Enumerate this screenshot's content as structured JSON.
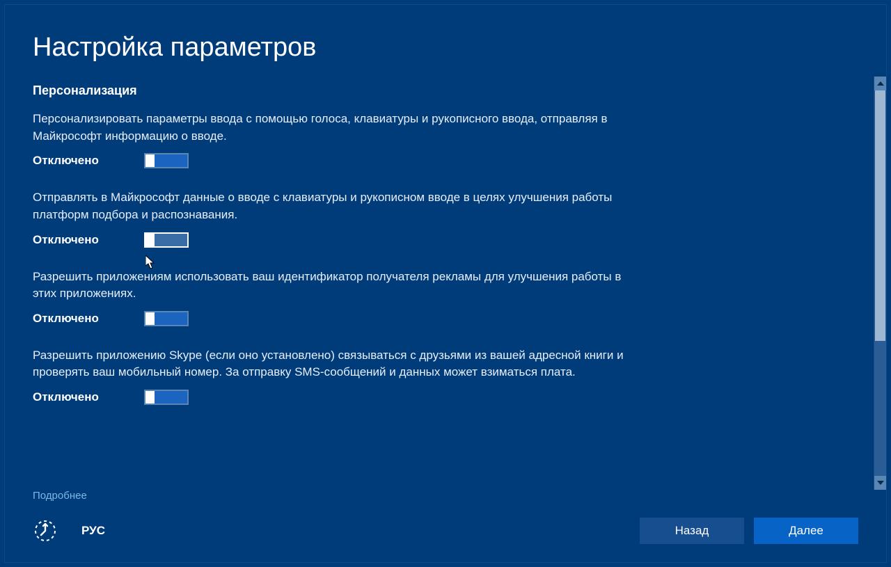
{
  "title": "Настройка параметров",
  "section_heading": "Персонализация",
  "state_off": "Отключено",
  "settings": [
    {
      "desc": "Персонализировать параметры ввода с помощью голоса, клавиатуры и рукописного ввода, отправляя в Майкрософт информацию о вводе.",
      "state": "Отключено",
      "hover": false
    },
    {
      "desc": "Отправлять в Майкрософт данные о вводе с клавиатуры и рукописном вводе в целях улучшения работы платформ подбора и распознавания.",
      "state": "Отключено",
      "hover": true
    },
    {
      "desc": "Разрешить приложениям использовать ваш идентификатор получателя рекламы для улучшения работы в этих приложениях.",
      "state": "Отключено",
      "hover": false
    },
    {
      "desc": "Разрешить приложению Skype (если оно установлено) связываться с друзьями из вашей адресной книги и проверять ваш мобильный номер. За отправку SMS-сообщений и данных может взиматься плата.",
      "state": "Отключено",
      "hover": false
    }
  ],
  "learn_more": "Подробнее",
  "language_indicator": "РУС",
  "buttons": {
    "back": "Назад",
    "next": "Далее"
  }
}
